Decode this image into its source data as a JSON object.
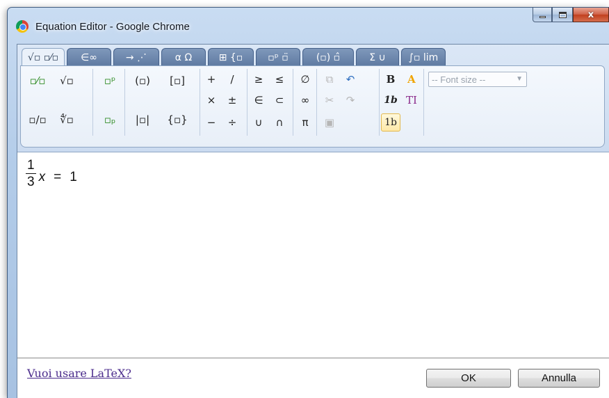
{
  "window": {
    "title": "Equation Editor - Google Chrome",
    "close_glyph": "x"
  },
  "tabs": [
    {
      "label": "√▫ ▫⁄▫",
      "icon": "radical-fraction"
    },
    {
      "label": "∈∞",
      "icon": "element-infinity"
    },
    {
      "label": "→ ⋰",
      "icon": "arrows-dots"
    },
    {
      "label": "α Ω",
      "icon": "greek-letters"
    },
    {
      "label": "⊞ {▫",
      "icon": "matrix-brace"
    },
    {
      "label": "▫ᵖ ▫̈",
      "icon": "script-accent"
    },
    {
      "label": "(▫) ▫̂",
      "icon": "brackets-accent"
    },
    {
      "label": "Σ ∪",
      "icon": "sum-union"
    },
    {
      "label": "∫▫ lim",
      "icon": "integral-limit"
    }
  ],
  "toolbar": {
    "fraction": "▫⁄▫",
    "sqrt": "√▫",
    "superscript": "▫ᵖ",
    "paren": "(▫)",
    "bracket": "[▫]",
    "slash_fraction": "▫/▫",
    "nth_root": "∜▫",
    "subscript": "▫ₚ",
    "abs": "|▫|",
    "brace": "{▫}",
    "plus": "+",
    "divslash": "/",
    "times": "×",
    "plusminus": "±",
    "minus": "−",
    "divide": "÷",
    "geq": "≥",
    "leq": "≤",
    "in": "∈",
    "subset": "⊂",
    "cup": "∪",
    "cap": "∩",
    "emptyset": "∅",
    "infinity": "∞",
    "pi": "π",
    "copy": "⧉",
    "undo": "↶",
    "cut": "✂",
    "redo": "↷",
    "paste": "▣",
    "bold": "B",
    "color": "A",
    "italic_b": "1b",
    "text": "TI",
    "selected_style": "1b",
    "font_size": "-- Font size --"
  },
  "equation": {
    "numerator": "1",
    "denominator": "3",
    "variable": "x",
    "equals": "=",
    "rhs": "1"
  },
  "footer": {
    "latex_link": "Vuoi usare LaTeX?",
    "ok": "OK",
    "cancel": "Annulla"
  }
}
